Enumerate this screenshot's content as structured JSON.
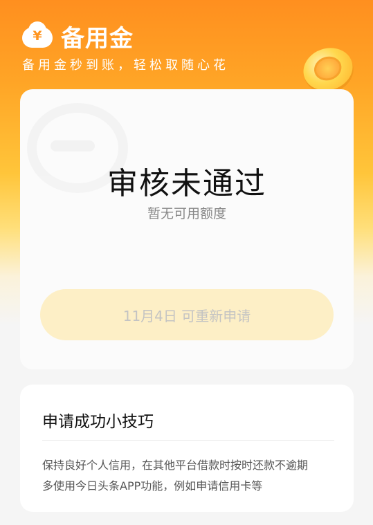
{
  "header": {
    "brand_icon_glyph": "¥",
    "brand_title": "备用金",
    "slogan": "备用金秒到账，轻松取随心花"
  },
  "status_card": {
    "title": "审核未通过",
    "subtitle": "暂无可用额度",
    "reapply_button": "11月4日 可重新申请"
  },
  "tips_card": {
    "title": "申请成功小技巧",
    "lines": [
      "保持良好个人信用，在其他平台借款时按时还款不逾期",
      "多使用今日头条APP功能，例如申请信用卡等"
    ]
  },
  "colors": {
    "brand_orange": "#ff8f1f",
    "button_disabled_bg": "#fdefc6",
    "button_disabled_text": "#c3c3c3"
  },
  "icons": [
    "cloud-yen-logo-icon",
    "gold-coin-icon"
  ]
}
